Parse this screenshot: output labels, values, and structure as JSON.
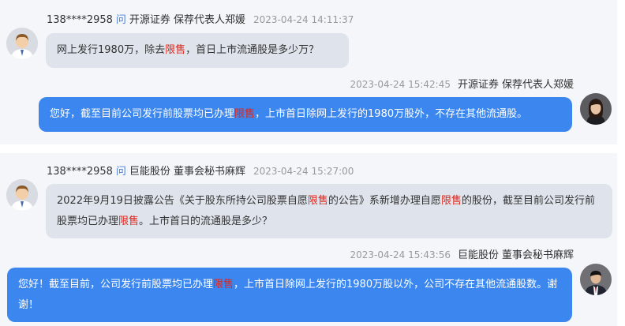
{
  "threads": [
    {
      "question": {
        "user": "138****2958",
        "ask_marker": "问",
        "company": "开源证券",
        "role": "保荐代表人郑媛",
        "time": "2023-04-24 14:11:37",
        "text_parts": [
          "网上发行1980万，除去",
          "限售",
          "，首日上市流通股是多少万？"
        ]
      },
      "answer": {
        "time": "2023-04-24 15:42:45",
        "company": "开源证券",
        "role": "保荐代表人郑媛",
        "text_parts": [
          "您好，截至目前公司发行前股票均已办理",
          "限售",
          "，上市首日除网上发行的1980万股外，不存在其他流通股。"
        ]
      }
    },
    {
      "question": {
        "user": "138****2958",
        "ask_marker": "问",
        "company": "巨能股份",
        "role": "董事会秘书麻辉",
        "time": "2023-04-24 15:27:00",
        "text_parts": [
          "2022年9月19日披露公告《关于股东所持公司股票自愿",
          "限售",
          "的公告》系新增办理自愿",
          "限售",
          "的股份，截至目前公司发行前股票均已办理",
          "限售",
          "。上市首日的流通股是多少？"
        ]
      },
      "answer": {
        "time": "2023-04-24 15:43:56",
        "company": "巨能股份",
        "role": "董事会秘书麻辉",
        "text_parts": [
          "您好！截至目前，公司发行前股票均已办理",
          "限售",
          "，上市首日除网上发行的1980万股以外，公司不存在其他流通股数。谢谢！"
        ]
      }
    }
  ],
  "highlight_color": "#e0251a",
  "answer_bubble_color": "#3c87ef",
  "question_bubble_color": "#dfe4ec",
  "icons": [
    "user-avatar-icon",
    "female-rep-avatar-icon",
    "male-rep-avatar-icon"
  ]
}
